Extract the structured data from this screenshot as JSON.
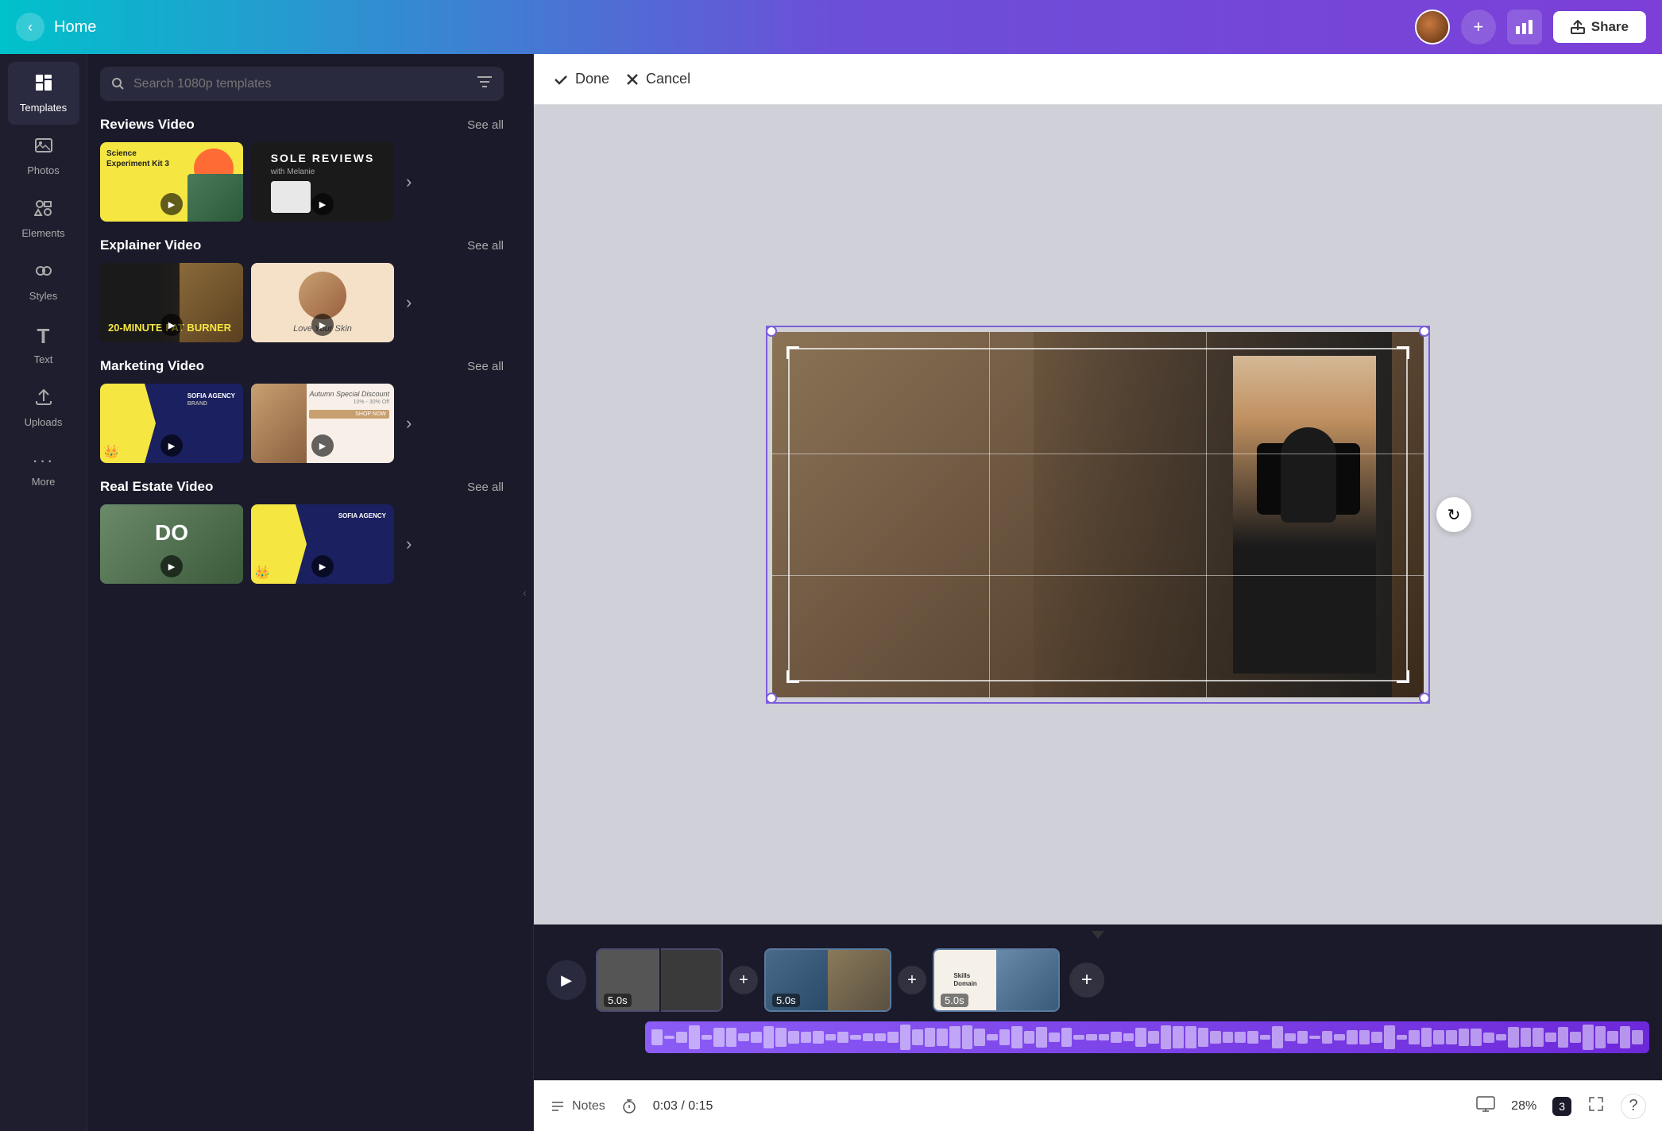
{
  "header": {
    "home_label": "Home",
    "back_icon": "‹",
    "add_icon": "+",
    "stats_icon": "📊",
    "share_label": "Share",
    "share_icon": "↑"
  },
  "sidebar": {
    "items": [
      {
        "id": "templates",
        "label": "Templates",
        "icon": "⊞",
        "active": true
      },
      {
        "id": "photos",
        "label": "Photos",
        "icon": "🖼"
      },
      {
        "id": "elements",
        "label": "Elements",
        "icon": "◇"
      },
      {
        "id": "styles",
        "label": "Styles",
        "icon": "🎨"
      },
      {
        "id": "text",
        "label": "Text",
        "icon": "T"
      },
      {
        "id": "uploads",
        "label": "Uploads",
        "icon": "⬆"
      },
      {
        "id": "more",
        "label": "More",
        "icon": "···"
      }
    ]
  },
  "template_panel": {
    "search_placeholder": "Search 1080p templates",
    "sections": [
      {
        "id": "reviews-video",
        "title": "Reviews Video",
        "see_all": "See all"
      },
      {
        "id": "explainer-video",
        "title": "Explainer Video",
        "see_all": "See all"
      },
      {
        "id": "marketing-video",
        "title": "Marketing Video",
        "see_all": "See all"
      },
      {
        "id": "real-estate-video",
        "title": "Real Estate Video",
        "see_all": "See all"
      }
    ]
  },
  "action_bar": {
    "done_label": "Done",
    "cancel_label": "Cancel"
  },
  "timeline": {
    "clips": [
      {
        "id": "clip1",
        "duration": "5.0s",
        "active": true
      },
      {
        "id": "clip2",
        "duration": "5.0s"
      },
      {
        "id": "clip3",
        "duration": "5.0s"
      }
    ],
    "current_time": "0:03",
    "total_time": "0:15"
  },
  "bottom_bar": {
    "notes_label": "Notes",
    "time_display": "0:03 / 0:15",
    "zoom_level": "28%",
    "page_count": "3",
    "notes_icon": "≡",
    "timer_icon": "⏱",
    "monitor_icon": "⬜",
    "expand_icon": "⤢",
    "help_icon": "?"
  },
  "canvas": {
    "rotate_icon": "↻"
  },
  "thumbnails": {
    "reviews_1_text": "Science Experiment Kit 3",
    "reviews_2_text": "SOLE REVIEWS",
    "explainer_1_text": "20-MINUTE FAT BURNER",
    "explainer_2_text": "Love Your Skin",
    "marketing_1_text": "SOFIA AGENCY",
    "marketing_2_text": "Autumn Special Discount",
    "realestate_1_text": "DO",
    "realestate_2_text": "SOFIA AGENCY",
    "skills_text1": "Skills",
    "skills_text2": "Domain"
  }
}
